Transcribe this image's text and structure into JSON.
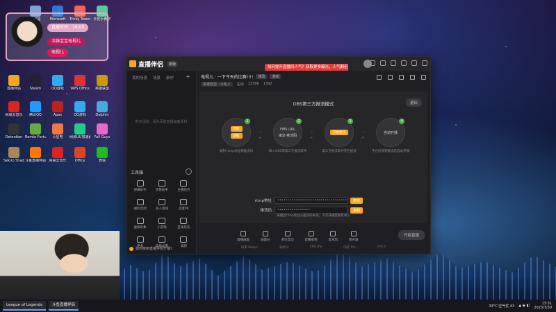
{
  "desktop_icons": [
    {
      "label": "回收站",
      "color": "#7aa0d6"
    },
    {
      "label": "Microsoft",
      "color": "#2b78d4"
    },
    {
      "label": "Tricky Towers",
      "color": "#e65"
    },
    {
      "label": "手把手教学",
      "color": "#5c9"
    },
    {
      "label": "直播伴侣",
      "color": "#f5a623"
    },
    {
      "label": "Steam",
      "color": "#223"
    },
    {
      "label": "QQ游戏",
      "color": "#3ae"
    },
    {
      "label": "WPS Office",
      "color": "#d33"
    },
    {
      "label": "英雄联盟",
      "color": "#c90"
    },
    {
      "label": "网易云音乐",
      "color": "#d22"
    },
    {
      "label": "腾讯QQ",
      "color": "#29f"
    },
    {
      "label": "Apex",
      "color": "#b22"
    },
    {
      "label": "QQ游戏",
      "color": "#3ae"
    },
    {
      "label": "Dolphin",
      "color": "#4ad"
    },
    {
      "label": "Detention",
      "color": "#333"
    },
    {
      "label": "Remto Fortune",
      "color": "#6a4"
    },
    {
      "label": "火星电",
      "color": "#e74"
    },
    {
      "label": "网易UU加速器",
      "color": "#2c8"
    },
    {
      "label": "Fall Guys",
      "color": "#e6c"
    },
    {
      "label": "Sekiro Shadows",
      "color": "#a85"
    },
    {
      "label": "斗鱼直播伴侣",
      "color": "#f70"
    },
    {
      "label": "网易云音乐",
      "color": "#d22"
    },
    {
      "label": "Office",
      "color": "#d42"
    },
    {
      "label": "微信",
      "color": "#2b2"
    }
  ],
  "widget": {
    "time_label": "直播时间：16:00",
    "event_label": "冶铸宝宝电视儿",
    "cute_label": "电视儿"
  },
  "app": {
    "name": "直播伴侣",
    "version": "新版",
    "promo": "如何提升直播间人气？获取更多曝光，人气翻倍",
    "sidebar": {
      "tabs": [
        "我的场景",
        "场景",
        "素材"
      ],
      "empty_hint": "暂无场景，请先添加直播画面素材",
      "tools_heading": "工具箱",
      "tools": [
        {
          "label": "弹幕助手"
        },
        {
          "label": "房管助手"
        },
        {
          "label": "主播任务"
        },
        {
          "label": "福利活动"
        },
        {
          "label": "多人连线"
        },
        {
          "label": "连麦PK"
        },
        {
          "label": "虚拟形象"
        },
        {
          "label": "小游戏"
        },
        {
          "label": "互动玩法"
        },
        {
          "label": "更多"
        },
        {
          "label": "高级设置"
        },
        {
          "label": "美颜"
        }
      ],
      "bottom_tip": "如何使用直播伴侣开播？"
    },
    "room": {
      "title": "电视儿 · 一下今天的比赛!!!!",
      "edit_chip": "修改",
      "category_chip": "游戏",
      "meta": [
        "英雄联盟 · 大乱斗",
        "在线",
        "12306",
        "1392"
      ]
    },
    "obs": {
      "mode_title": "OBS第三方推流模式",
      "exit_label": "退出",
      "steps": [
        {
          "num": "1",
          "btn": "获取",
          "btn2": "获取",
          "desc": "复制 rtmp地址和推流码"
        },
        {
          "num": "2",
          "top": "FMS URL",
          "mid": "串流·推流码",
          "desc": "填入OBS或第三方推流软件"
        },
        {
          "num": "3",
          "btn": "开始推流",
          "desc": "第三方推流软件开启推流"
        },
        {
          "num": "4",
          "top": "自动开播",
          "desc": "平台检测到推流后自动开播"
        }
      ],
      "rtmp_label": "rtmp地址",
      "rtmp_value": "••••••••••••••••••••••••••••••••••",
      "key_label": "推流码",
      "key_value": "••••••••••••••••",
      "copy_label": "复制",
      "hint": "关播后rtmp地址与推流码失效，下次开播需重新填写"
    },
    "toolbar": [
      {
        "label": "直播画面"
      },
      {
        "label": "画面分"
      },
      {
        "label": "多位互动"
      },
      {
        "label": "直播录制"
      },
      {
        "label": "麦克风"
      },
      {
        "label": "扬声器"
      }
    ],
    "start_label": "开始直播",
    "status": [
      "码率 0kbps",
      "丢帧 0",
      "CPU 0%",
      "内存 0%",
      "FPS 0"
    ]
  },
  "taskbar": {
    "tasks": [
      "League of Legends",
      "斗鱼直播伴侣"
    ],
    "weather": "33°C 空气优 43",
    "time": "13:31",
    "date": "2023/7/30"
  }
}
